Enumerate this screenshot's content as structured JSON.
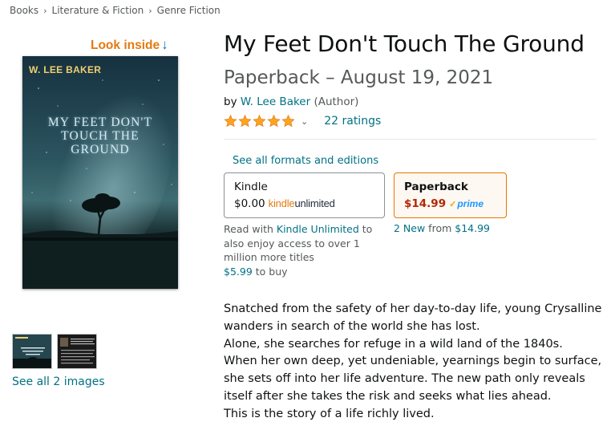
{
  "breadcrumb": [
    "Books",
    "Literature & Fiction",
    "Genre Fiction"
  ],
  "look_inside": {
    "label": "Look inside",
    "arrow": "↓"
  },
  "cover": {
    "author": "W. LEE BAKER",
    "title": "MY FEET DON'T\nTOUCH  THE\nGROUND"
  },
  "images": {
    "see_all": "See all 2 images"
  },
  "product": {
    "title": "My Feet Don't Touch The Ground",
    "subtitle": "Paperback – August 19, 2021",
    "by": "by",
    "author": "W. Lee Baker",
    "author_role": "(Author)",
    "rating_stars": 5,
    "ratings_count": "22 ratings"
  },
  "formats": {
    "see_all": "See all formats and editions",
    "kindle": {
      "name": "Kindle",
      "price": "$0.00",
      "brand_k": "kindle",
      "brand_u": "unlimited"
    },
    "paperback": {
      "name": "Paperback",
      "price": "$14.99",
      "prime": "prime"
    }
  },
  "kindle_note": {
    "pre": "Read with ",
    "link": "Kindle Unlimited",
    "post": " to also enjoy access to over 1 million more titles",
    "buy_price": "$5.99",
    "buy_suffix": " to buy"
  },
  "new_from": {
    "link": "2 New",
    "text": " from ",
    "price": "$14.99"
  },
  "description": [
    "Snatched from the safety of her day-to-day life, young Crysalline",
    "wanders in search of the world she has lost.",
    "Alone, she searches for refuge in a wild land of the 1840s.",
    "When her own deep, yet undeniable, yearnings begin to surface,",
    "she sets off into her life adventure. The new path only reveals",
    "itself after she takes the risk and seeks what lies ahead.",
    "This is the story of a life richly lived."
  ],
  "colors": {
    "link": "#007185",
    "star": "#ffa41c",
    "price": "#b12704",
    "look_inside": "#e47911",
    "selected_border": "#e77600"
  },
  "icons": [
    "chevron-down-icon",
    "star-icon",
    "down-arrow-icon",
    "prime-check-icon"
  ]
}
